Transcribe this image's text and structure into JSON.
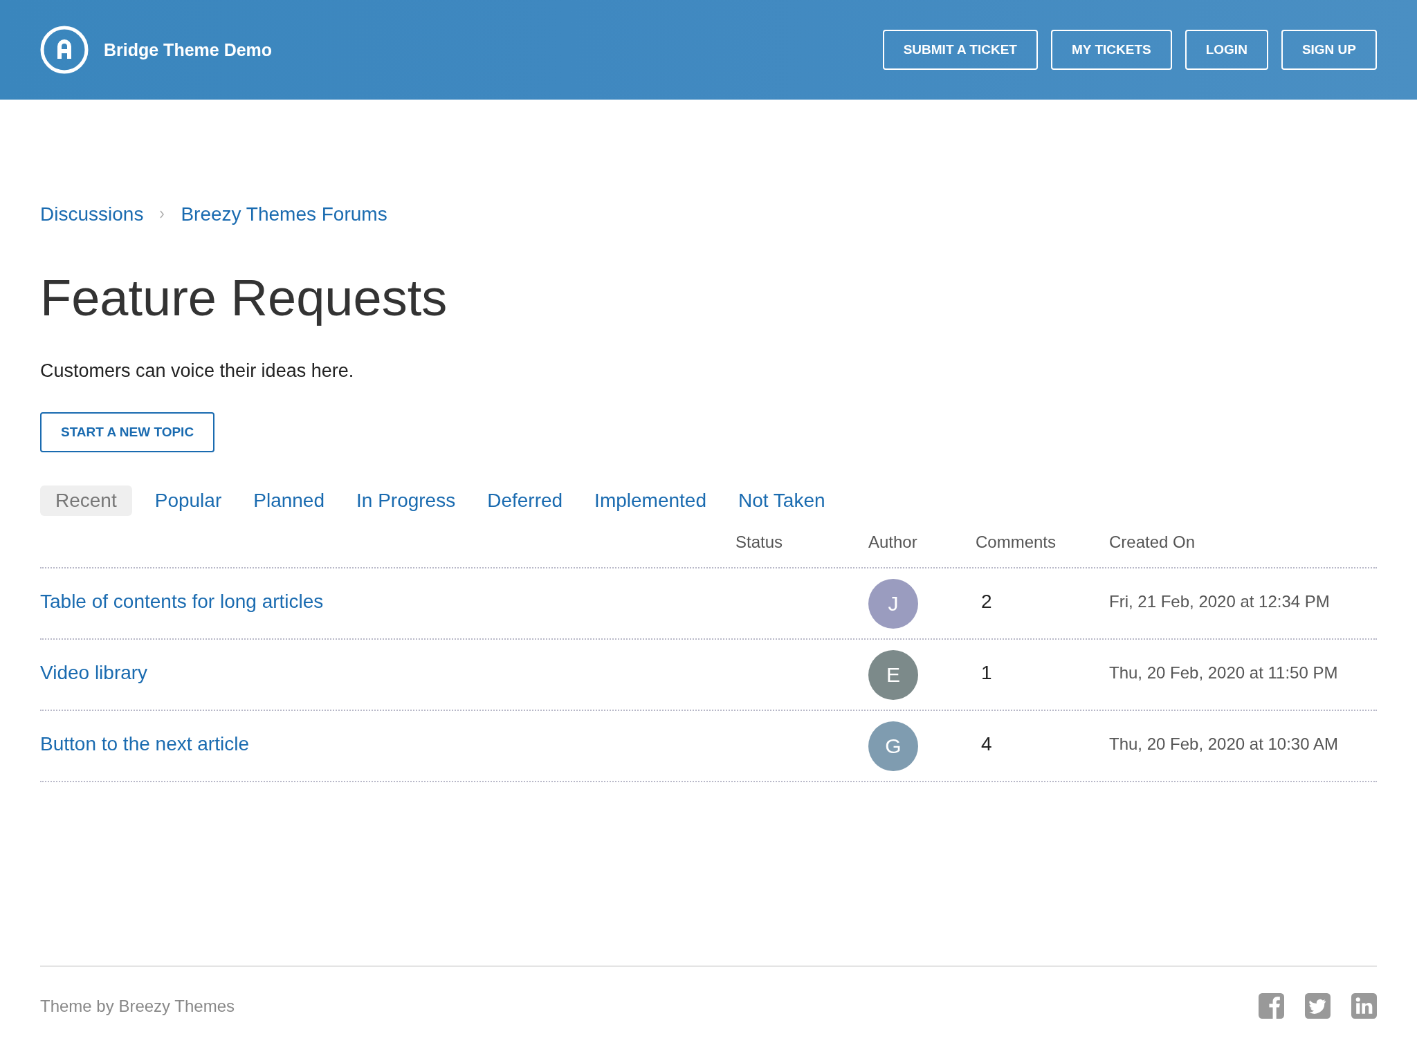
{
  "header": {
    "site_title": "Bridge Theme Demo",
    "buttons": [
      "SUBMIT A TICKET",
      "MY TICKETS",
      "LOGIN",
      "SIGN UP"
    ]
  },
  "breadcrumb": [
    "Discussions",
    "Breezy Themes Forums"
  ],
  "title": "Feature Requests",
  "description": "Customers can voice their ideas here.",
  "new_topic_button": "START A NEW TOPIC",
  "tabs": [
    {
      "label": "Recent",
      "selected": true
    },
    {
      "label": "Popular",
      "selected": false
    },
    {
      "label": "Planned",
      "selected": false
    },
    {
      "label": "In Progress",
      "selected": false
    },
    {
      "label": "Deferred",
      "selected": false
    },
    {
      "label": "Implemented",
      "selected": false
    },
    {
      "label": "Not Taken",
      "selected": false
    }
  ],
  "table": {
    "columns": [
      "Status",
      "Author",
      "Comments",
      "Created On"
    ],
    "rows": [
      {
        "title": "Table of contents for long articles",
        "author_initial": "J",
        "color": "#9a9cbf",
        "comments": "2",
        "created_on": "Fri, 21 Feb, 2020 at 12:34 PM"
      },
      {
        "title": "Video library",
        "author_initial": "E",
        "color": "#7c8a8a",
        "comments": "1",
        "created_on": "Thu, 20 Feb, 2020 at 11:50 PM"
      },
      {
        "title": "Button to the next article",
        "author_initial": "G",
        "color": "#7f9cb0",
        "comments": "4",
        "created_on": "Thu, 20 Feb, 2020 at 10:30 AM"
      }
    ]
  },
  "footer": {
    "credit": "Theme by Breezy Themes"
  }
}
